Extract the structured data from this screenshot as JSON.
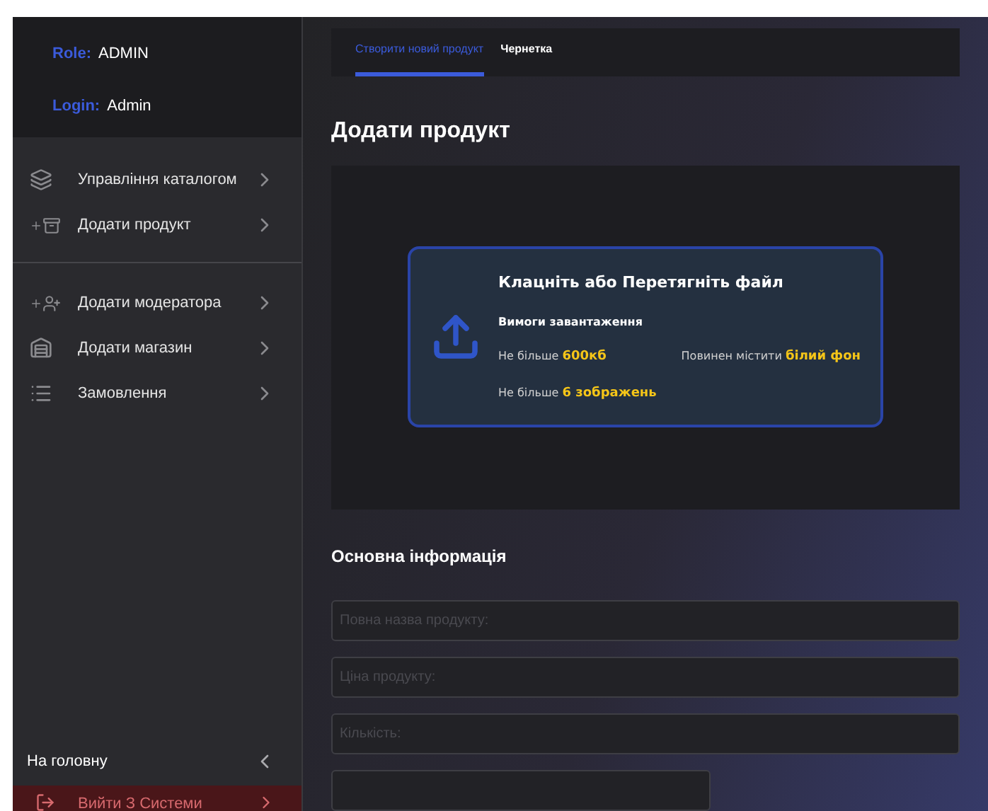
{
  "sidebar": {
    "role_label": "Role:",
    "role": "ADMIN",
    "login_label": "Login:",
    "login": "Admin",
    "groups": [
      [
        {
          "label": "Управління каталогом",
          "kind": "catalog"
        },
        {
          "label": "Додати продукт",
          "kind": "product"
        }
      ],
      [
        {
          "label": "Додати модератора",
          "kind": "moderator"
        },
        {
          "label": "Додати магазин",
          "kind": "store"
        },
        {
          "label": "Замовлення",
          "kind": "orders"
        }
      ]
    ],
    "home": "На головну",
    "logout": "Вийти З Системи"
  },
  "tabs": [
    {
      "label": "Створити новий продукт",
      "selected": true
    },
    {
      "label": "Чернетка",
      "selected": false
    }
  ],
  "title": "Додати продукт",
  "upload": {
    "title": "Клацніть або Перетягніть файл",
    "subtitle": "Вимоги завантаження",
    "requirements": [
      "Не більше **600кб**",
      "Повинен містити **білий фон**",
      "Не більше **6 зображень**"
    ]
  },
  "section": "Основна інформація",
  "fields": [
    {
      "placeholder": "Повна назва продукту:"
    },
    {
      "placeholder": "Ціна продукту:"
    },
    {
      "placeholder": "Кількість:"
    }
  ]
}
